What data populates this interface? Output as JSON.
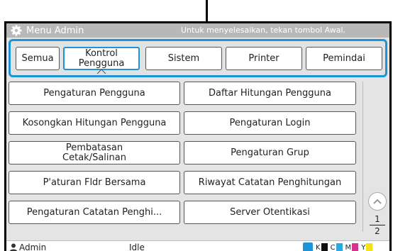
{
  "titlebar": {
    "title": "Menu Admin",
    "hint": "Untuk menyelesaikan, tekan tombol Awal."
  },
  "tabs": [
    {
      "label": "Semua",
      "active": false
    },
    {
      "label": "Kontrol Pengguna",
      "active": true
    },
    {
      "label": "Sistem",
      "active": false
    },
    {
      "label": "Printer",
      "active": false
    },
    {
      "label": "Pemindai",
      "active": false
    }
  ],
  "menu_items": [
    {
      "label": "Pengaturan Pengguna"
    },
    {
      "label": "Daftar Hitungan Pengguna"
    },
    {
      "label": "Kosongkan Hitungan Pengguna"
    },
    {
      "label": "Pengaturan Login"
    },
    {
      "label": "Pembatasan Cetak/Salinan"
    },
    {
      "label": "Pengaturan Grup"
    },
    {
      "label": "P'aturan Fldr Bersama"
    },
    {
      "label": "Riwayat Catatan Penghitungan"
    },
    {
      "label": "Pengaturan Catatan Penghi..."
    },
    {
      "label": "Server Otentikasi"
    }
  ],
  "pagination": {
    "current": "1",
    "total": "2"
  },
  "statusbar": {
    "user": "Admin",
    "status": "Idle",
    "inks": [
      {
        "label": "K",
        "color": "#111111"
      },
      {
        "label": "C",
        "color": "#2ea8e0"
      },
      {
        "label": "M",
        "color": "#d6338f"
      },
      {
        "label": "Y",
        "color": "#f2e21a"
      }
    ]
  },
  "colors": {
    "accent": "#1e94d6",
    "titlebar_bg": "#b8b8b8",
    "panel_bg": "#e4e4e4"
  }
}
